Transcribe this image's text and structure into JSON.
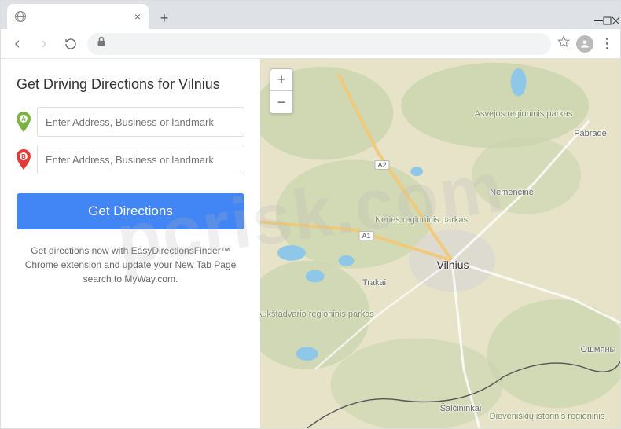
{
  "window": {
    "tab_title": ""
  },
  "sidebar": {
    "heading": "Get Driving Directions for Vilnius",
    "input_a_placeholder": "Enter Address, Business or landmark",
    "input_b_placeholder": "Enter Address, Business or landmark",
    "button_label": "Get Directions",
    "blurb": "Get directions now with EasyDirectionsFinder™ Chrome extension and update your New Tab Page search to MyWay.com."
  },
  "map": {
    "zoom_in": "+",
    "zoom_out": "−",
    "labels": {
      "vilnius": "Vilnius",
      "trakai": "Trakai",
      "nemencine": "Nemenčinė",
      "pabrade": "Pabradė",
      "salcininkai": "Šalčininkai",
      "oshmyany": "Ошмяны",
      "asvejos": "Asvejos regioninis parkas",
      "neries": "Neries regioninis parkas",
      "aukstadvario": "Aukštadvario regioninis parkas",
      "dieveniskiu": "Dieveniškių istorinis regioninis",
      "road_a2": "A2",
      "road_a1": "A1"
    }
  },
  "watermark": "pcrisk.com"
}
